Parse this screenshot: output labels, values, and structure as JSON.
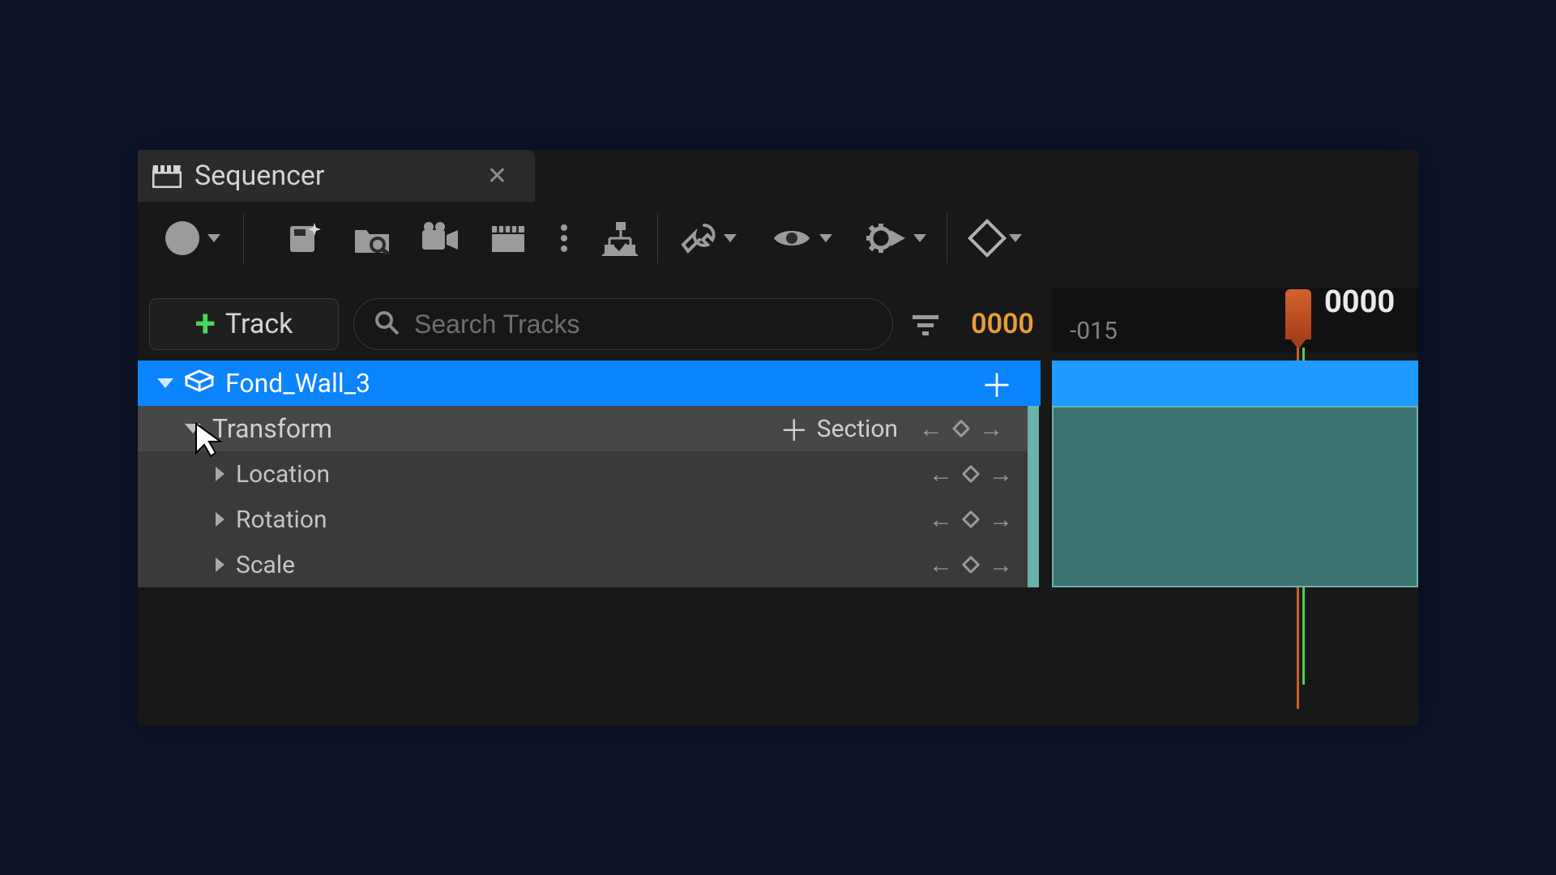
{
  "tab": {
    "title": "Sequencer"
  },
  "toolbar": {
    "track_label": "Track",
    "search_placeholder": "Search Tracks",
    "frame_field": "0000"
  },
  "ruler": {
    "tick_left": "-015",
    "playhead_frame": "0000"
  },
  "tree": {
    "actor": {
      "name": "Fond_Wall_3"
    },
    "transform": {
      "label": "Transform",
      "section_label": "Section",
      "children": [
        {
          "label": "Location"
        },
        {
          "label": "Rotation"
        },
        {
          "label": "Scale"
        }
      ]
    }
  },
  "colors": {
    "selection": "#0a84ff",
    "accent": "#e79e35",
    "section": "#3d7370"
  }
}
